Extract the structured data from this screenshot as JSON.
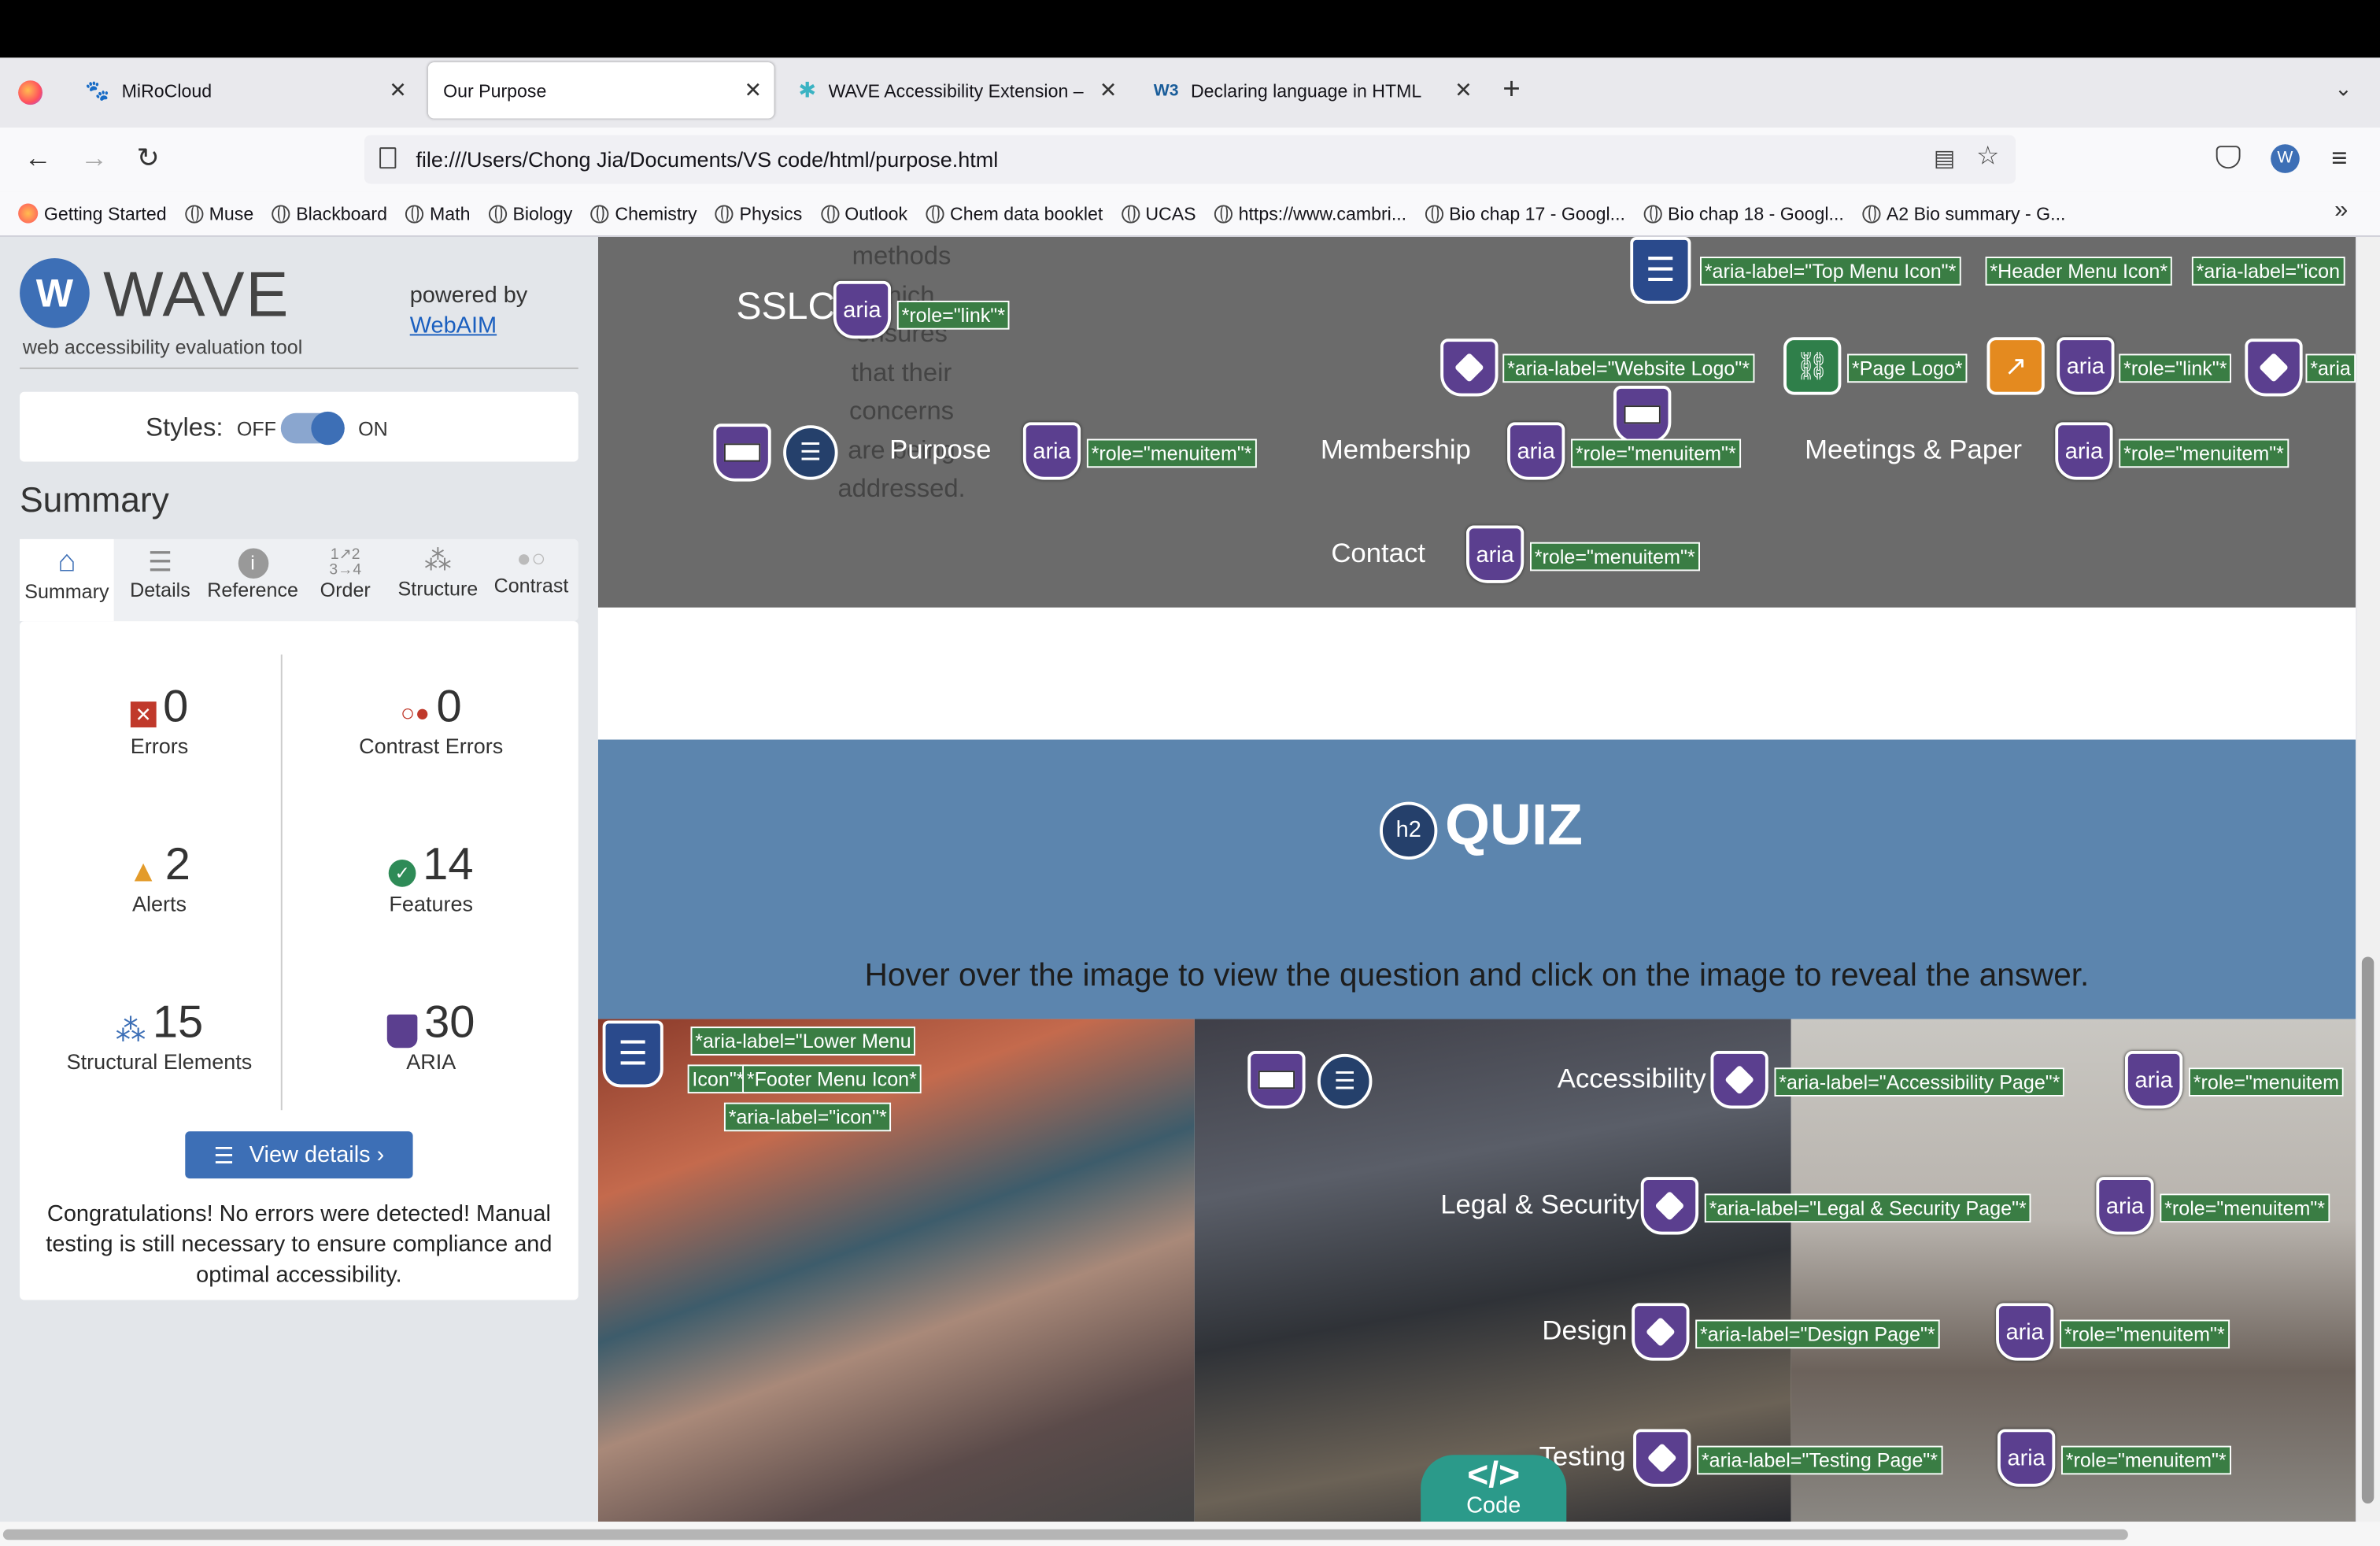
{
  "browser": {
    "tabs": [
      {
        "title": "MiRoCloud"
      },
      {
        "title": "Our Purpose"
      },
      {
        "title": "WAVE Accessibility Extension –"
      },
      {
        "title": "Declaring language in HTML"
      }
    ],
    "url": "file:///Users/Chong Jia/Documents/VS code/html/purpose.html",
    "bookmarks": [
      "Getting Started",
      "Muse",
      "Blackboard",
      "Math",
      "Biology",
      "Chemistry",
      "Physics",
      "Outlook",
      "Chem data booklet",
      "UCAS",
      "https://www.cambri...",
      "Bio chap 17 - Googl...",
      "Bio chap 18 - Googl...",
      "A2 Bio summary - G..."
    ]
  },
  "wave": {
    "logo_text": "WAVE",
    "tagline": "web accessibility evaluation tool",
    "powered_by": "powered by",
    "webaim": "WebAIM",
    "styles_label": "Styles:",
    "off": "OFF",
    "on": "ON",
    "summary_heading": "Summary",
    "tabs": [
      "Summary",
      "Details",
      "Reference",
      "Order",
      "Structure",
      "Contrast"
    ],
    "stats": {
      "errors": {
        "count": "0",
        "label": "Errors"
      },
      "contrast": {
        "count": "0",
        "label": "Contrast Errors"
      },
      "alerts": {
        "count": "2",
        "label": "Alerts"
      },
      "features": {
        "count": "14",
        "label": "Features"
      },
      "structural": {
        "count": "15",
        "label": "Structural Elements"
      },
      "aria": {
        "count": "30",
        "label": "ARIA"
      }
    },
    "view_details": "View details ›",
    "message": "Congratulations! No errors were detected! Manual testing is still necessary to ensure compliance and optimal accessibility."
  },
  "page": {
    "top_text": [
      "methods",
      "which",
      "ensures",
      "that their",
      "concerns",
      "are being",
      "addressed."
    ],
    "sslc": "SSLC",
    "nav": [
      "Purpose",
      "Membership",
      "Meetings & Paper",
      "Contact"
    ],
    "quiz_title": "QUIZ",
    "quiz_subtitle": "Hover over the image to view the question and click on the image to reveal the answer.",
    "footer_nav": [
      "Accessibility",
      "Legal & Security",
      "Design",
      "Testing"
    ],
    "code_label": "Code",
    "aria_text": "aria",
    "h2_text": "h2"
  },
  "wave_labels": {
    "role_link": "*role=\"link\"*",
    "role_menuitem": "*role=\"menuitem\"*",
    "top_menu": "*aria-label=\"Top Menu Icon\"*",
    "header_menu": "*Header Menu Icon*",
    "aria_icon_cut": "*aria-label=\"icon",
    "website_logo": "*aria-label=\"Website Logo\"*",
    "page_logo": "*Page Logo*",
    "aria_cut": "*aria",
    "lower_menu_1": "*aria-label=\"Lower Menu",
    "lower_menu_2": "Icon\"*",
    "footer_menu": "*Footer Menu Icon*",
    "aria_icon": "*aria-label=\"icon\"*",
    "accessibility_page": "*aria-label=\"Accessibility Page\"*",
    "legal_page": "*aria-label=\"Legal & Security Page\"*",
    "design_page": "*aria-label=\"Design Page\"*",
    "testing_page": "*aria-label=\"Testing Page\"*",
    "role_menuitem_cut": "*role=\"menuitem"
  },
  "colors": {
    "wave_blue": "#3d6fb6",
    "aria_purple": "#5b3f8f",
    "label_green": "#3a7d44",
    "quiz_blue": "#5c85ae",
    "header_gray": "#6b6b6b"
  }
}
